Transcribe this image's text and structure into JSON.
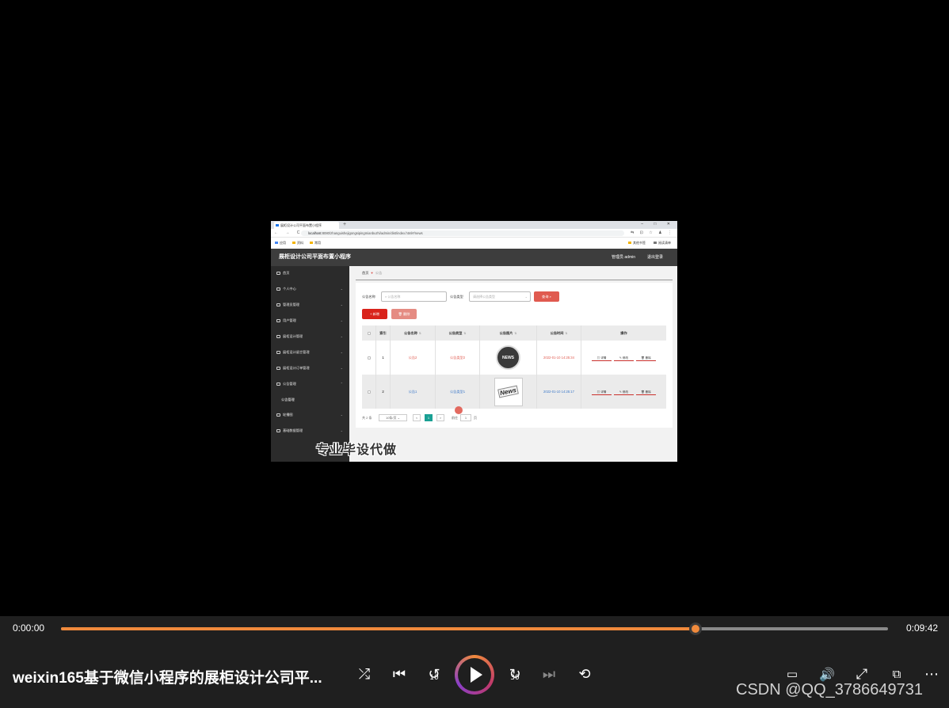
{
  "browser": {
    "tab_title": "展柜设计公司平面布置小程序",
    "new_tab": "+",
    "window_controls": "– □ ✕",
    "nav_buttons": "← → C",
    "url_host": "localhost",
    "url_rest": ":8080/zhanguishejigongsipingmianbuzhi/admin/dist/index.html#/news",
    "toolbar_icons": "⇆ ⊡ ☆ ♟ ⋮",
    "bookmarks": [
      "应用",
      "资料",
      "常用"
    ],
    "bookmarks_right": [
      "其他书签",
      "阅读清单"
    ]
  },
  "app": {
    "brand": "展柜设计公司平面布置小程序",
    "user": "管理员 admin",
    "logout": "退出登录"
  },
  "sidebar": {
    "items": [
      {
        "label": "首页"
      },
      {
        "label": "个人中心"
      },
      {
        "label": "管理员管理"
      },
      {
        "label": "用户管理"
      },
      {
        "label": "展柜设计管理"
      },
      {
        "label": "展柜设计留言管理"
      },
      {
        "label": "展柜设计订单管理"
      },
      {
        "label": "公告管理"
      },
      {
        "label": "轮播图"
      },
      {
        "label": "基础数据管理"
      }
    ],
    "sub_active": "公告管理"
  },
  "breadcrumb": {
    "home": "首页",
    "current": "公告"
  },
  "search": {
    "name_label": "公告名称",
    "name_placeholder": "公告名称",
    "type_label": "公告类型",
    "type_placeholder": "请选择公告类型",
    "query_btn": "查询",
    "add_btn": "新增",
    "delete_btn": "删除"
  },
  "table": {
    "headers": [
      "索引",
      "公告名称",
      "公告类型",
      "公告图片",
      "公告时间",
      "操作"
    ],
    "rows": [
      {
        "index": "1",
        "name": "公告2",
        "type": "公告类型2",
        "img": "NEWS",
        "time": "2022-01-10 14:25:34",
        "detail": "详情",
        "edit": "修改",
        "del": "删除"
      },
      {
        "index": "2",
        "name": "公告1",
        "type": "公告类型1",
        "img": "News",
        "time": "2022-01-10 14:25:17",
        "detail": "详情",
        "edit": "修改",
        "del": "删除"
      }
    ]
  },
  "pager": {
    "total": "共 2 条",
    "page_size": "10条/页",
    "prev": "<",
    "current": "1",
    "next": ">",
    "goto_label": "前往",
    "goto_value": "1",
    "page_suffix": "页"
  },
  "watermark": "专业毕设代做",
  "player": {
    "time_current": "0:00:00",
    "time_total": "0:09:42",
    "progress": 0.767,
    "title": "weixin165基于微信小程序的展柜设计公司平...",
    "rewind_label": "10",
    "forward_label": "30",
    "credit": "CSDN @QQ_3786649731",
    "accent": "#f08a3c"
  }
}
